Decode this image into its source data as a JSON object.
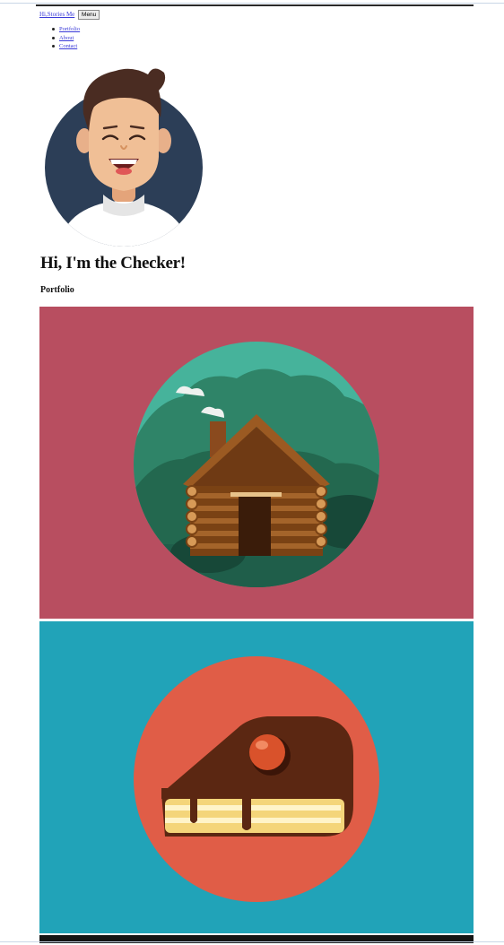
{
  "header": {
    "brand": "Hi,Stories Me",
    "menu_button": "Menu"
  },
  "nav": {
    "items": [
      {
        "label": "Portfolio"
      },
      {
        "label": "About"
      },
      {
        "label": "Contact"
      }
    ]
  },
  "hero": {
    "greeting": "Hi, I'm the Checker!",
    "avatar_icon": "smiling-person-avatar"
  },
  "portfolio": {
    "heading": "Portfolio",
    "items": [
      {
        "icon": "log-cabin-illustration",
        "background": "#b84e60",
        "circle": "#46b39b"
      },
      {
        "icon": "cake-slice-illustration",
        "background": "#21a3b8",
        "circle": "#e05d47"
      }
    ]
  }
}
